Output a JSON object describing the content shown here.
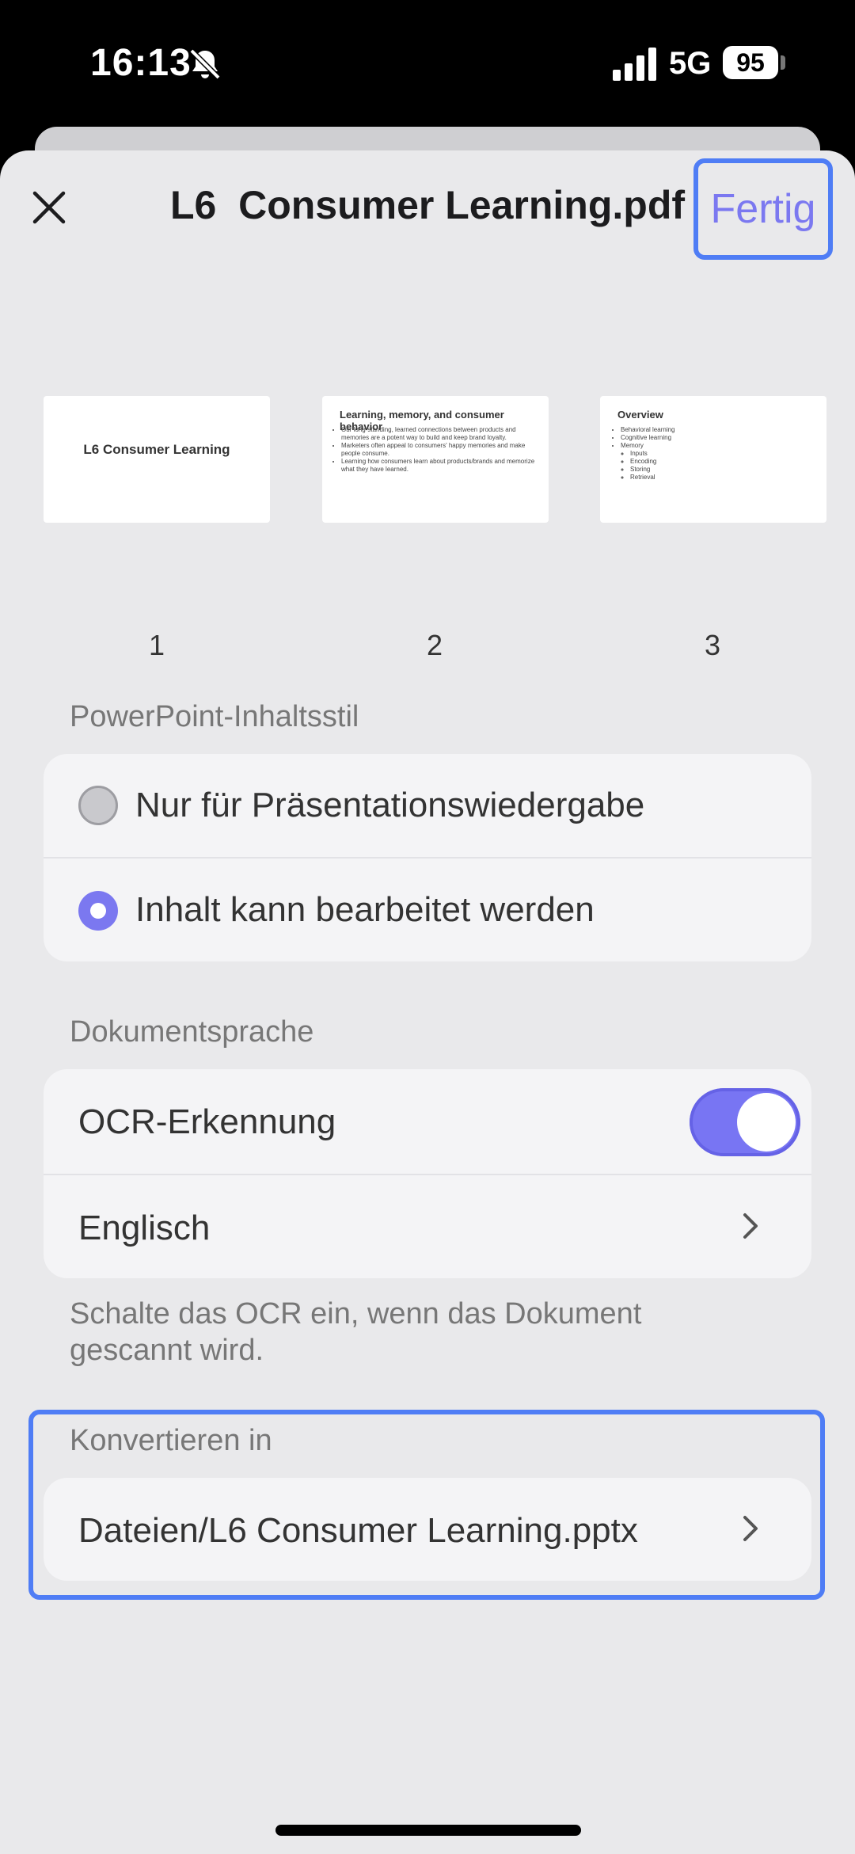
{
  "status_bar": {
    "time": "16:13",
    "network": "5G",
    "battery": "95"
  },
  "header": {
    "title": "L6  Consumer Learning.pdf",
    "done_label": "Fertig"
  },
  "pages": [
    {
      "number": "1",
      "title": "L6 Consumer Learning"
    },
    {
      "number": "2",
      "title": "Learning, memory, and consumer behavior",
      "bullets": [
        "Our long-standing, learned connections between products and memories are a potent way to build and keep brand loyalty.",
        "Marketers often appeal to consumers' happy memories and make people consume.",
        "Learning how consumers learn about products/brands and memorize what they have learned."
      ]
    },
    {
      "number": "3",
      "title": "Overview",
      "bullets": [
        "Behavioral learning",
        "Cognitive learning",
        "Memory"
      ],
      "sub_bullets": [
        "Inputs",
        "Encoding",
        "Storing",
        "Retrieval"
      ]
    }
  ],
  "content_style": {
    "label": "PowerPoint-Inhaltsstil",
    "options": [
      {
        "label": "Nur für Präsentationswiedergabe",
        "selected": false
      },
      {
        "label": "Inhalt kann bearbeitet werden",
        "selected": true
      }
    ]
  },
  "document_language": {
    "label": "Dokumentsprache",
    "ocr_label": "OCR-Erkennung",
    "ocr_enabled": true,
    "language": "Englisch",
    "note": "Schalte das OCR ein, wenn das Dokument gescannt wird."
  },
  "convert": {
    "label": "Konvertieren in",
    "path": "Dateien/L6  Consumer Learning.pptx"
  },
  "colors": {
    "accent": "#7B78F0",
    "highlight": "#4F7DF5",
    "background": "#E9E9EB"
  }
}
